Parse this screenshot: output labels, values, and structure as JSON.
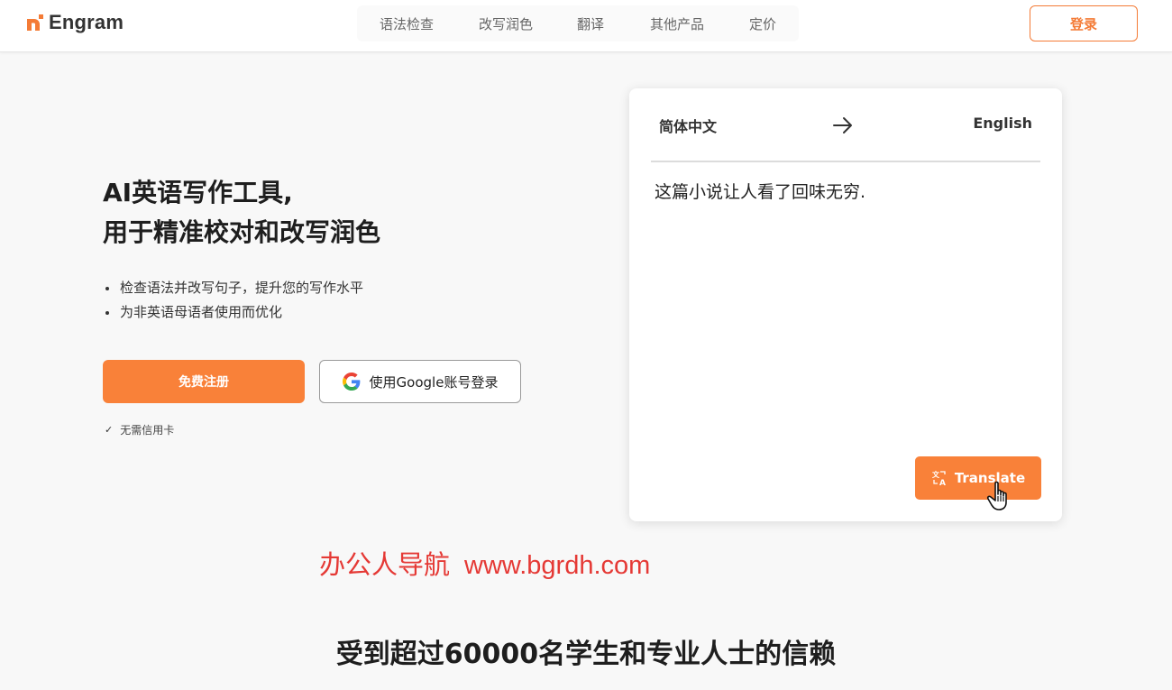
{
  "header": {
    "brand": "Engram",
    "nav": [
      "语法检查",
      "改写润色",
      "翻译",
      "其他产品",
      "定价"
    ],
    "login_label": "登录"
  },
  "hero": {
    "title_line1": "AI英语写作工具,",
    "title_line2": "用于精准校对和改写润色",
    "bullets": [
      "检查语法并改写句子，提升您的写作水平",
      "为非英语母语者使用而优化"
    ],
    "signup_label": "免费注册",
    "google_label": "使用Google账号登录",
    "no_card_label": "无需信用卡"
  },
  "translator": {
    "source_lang": "简体中文",
    "target_lang": "English",
    "source_text": "这篇小说让人看了回味无穷.",
    "translate_label": "Translate"
  },
  "watermark": {
    "name": "办公人导航",
    "url": "www.bgrdh.com"
  },
  "trust_heading": "受到超过60000名学生和专业人士的信赖",
  "colors": {
    "accent": "#f98139",
    "watermark": "#e53935"
  }
}
